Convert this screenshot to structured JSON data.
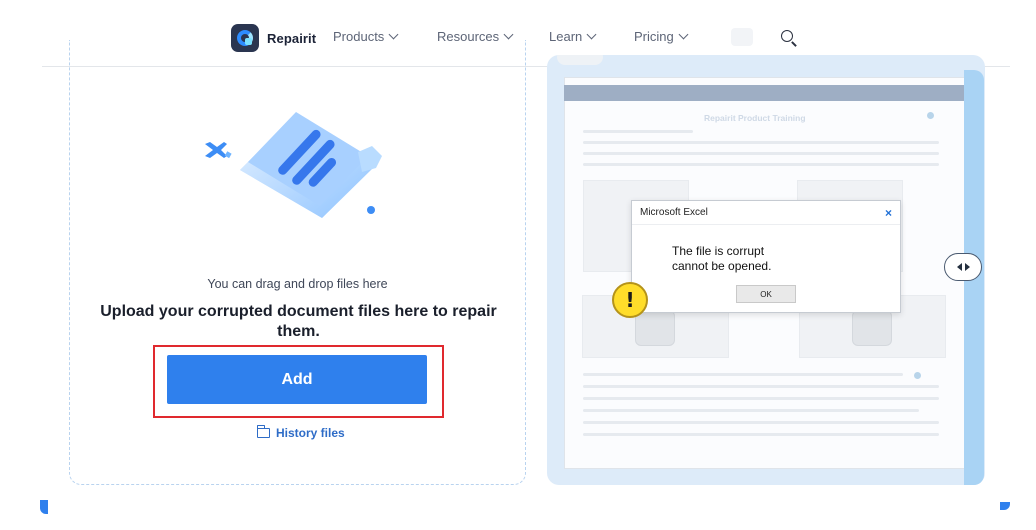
{
  "nav": {
    "brand": "Repairit",
    "items": [
      {
        "label": "Products"
      },
      {
        "label": "Resources"
      },
      {
        "label": "Learn"
      },
      {
        "label": "Pricing"
      }
    ]
  },
  "upload": {
    "drag_text": "You can drag and drop files here",
    "title": "Upload your corrupted document files here to repair them.",
    "add_label": "Add",
    "history_label": "History files"
  },
  "preview": {
    "doc_title": "Repairit Product Training",
    "dialog": {
      "title": "Microsoft Excel",
      "close": "×",
      "line1": "The file is corrupt",
      "line2": "cannot be opened.",
      "ok": "OK"
    },
    "warning_glyph": "!"
  },
  "colors": {
    "accent": "#2f80ed",
    "highlight": "#e0292e",
    "warning": "#ffdd2a"
  }
}
